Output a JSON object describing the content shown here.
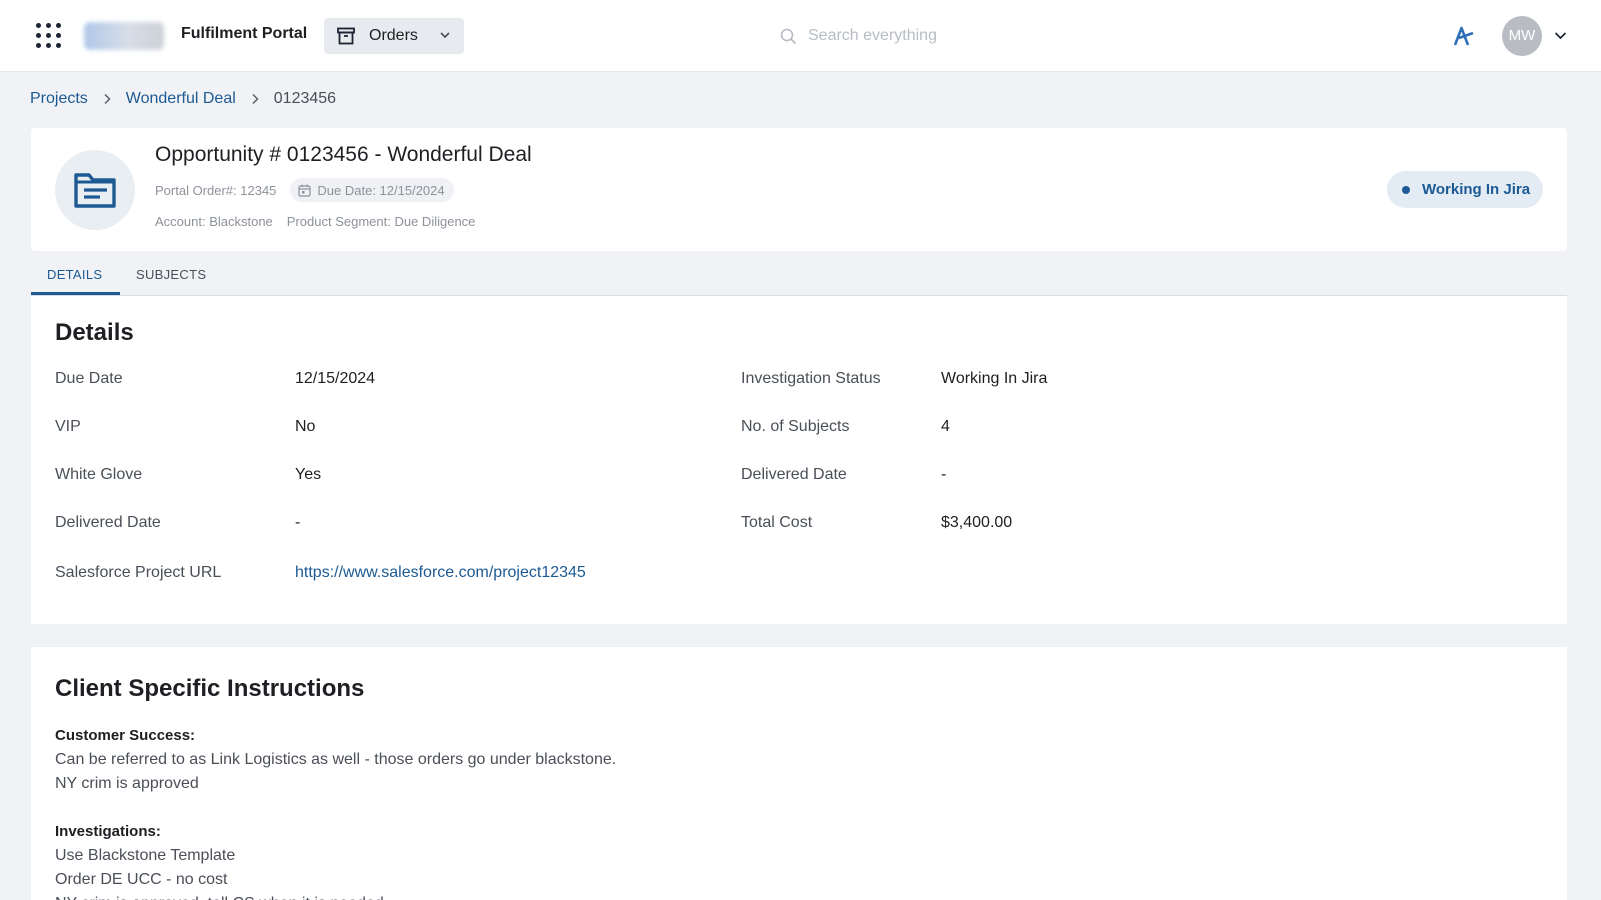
{
  "header": {
    "app_title": "Fulfilment Portal",
    "module": "Orders",
    "search_placeholder": "Search everything",
    "user_initials": "MW"
  },
  "breadcrumb": [
    "Projects",
    "Wonderful Deal",
    "0123456"
  ],
  "opportunity": {
    "title": "Opportunity # 0123456 - Wonderful Deal",
    "portal_order": "Portal Order#: 12345",
    "due_date": "Due Date: 12/15/2024",
    "account": "Account: Blackstone",
    "product_segment": "Product Segment: Due Diligence",
    "status": "Working In Jira"
  },
  "tabs": [
    "DETAILS",
    "SUBJECTS"
  ],
  "details": {
    "title": "Details",
    "left": [
      {
        "label": "Due Date",
        "value": "12/15/2024"
      },
      {
        "label": "VIP",
        "value": "No"
      },
      {
        "label": "White Glove",
        "value": "Yes"
      },
      {
        "label": "Delivered Date",
        "value": "-"
      },
      {
        "label": "Salesforce Project URL",
        "value": "https://www.salesforce.com/project12345"
      }
    ],
    "right": [
      {
        "label": "Investigation  Status",
        "value": "Working In Jira"
      },
      {
        "label": "No. of Subjects",
        "value": "4"
      },
      {
        "label": "Delivered Date",
        "value": "-"
      },
      {
        "label": "Total Cost",
        "value": "$3,400.00"
      }
    ]
  },
  "instructions": {
    "title": "Client Specific Instructions",
    "groups": [
      {
        "heading": "Customer Success:",
        "lines": [
          "Can be referred to as Link Logistics as well - those orders go under blackstone.",
          "NY crim is approved"
        ]
      },
      {
        "heading": "Investigations:",
        "lines": [
          "Use Blackstone Template",
          "Order DE UCC - no cost",
          "NY crim is approved, tell CS when it is needed"
        ]
      }
    ]
  },
  "colors": {
    "accent": "#1d5a93",
    "page_background": "#f0f2f5",
    "status_pill_background": "#e3ecf4",
    "avatar_background": "#b9bdc3"
  },
  "icons": [
    "apps-grid-icon",
    "company-logo",
    "archive-box-icon",
    "chevron-down-icon",
    "search-icon",
    "brand-mark-icon",
    "chevron-right-icon",
    "calendar-icon",
    "folder-document-icon"
  ]
}
